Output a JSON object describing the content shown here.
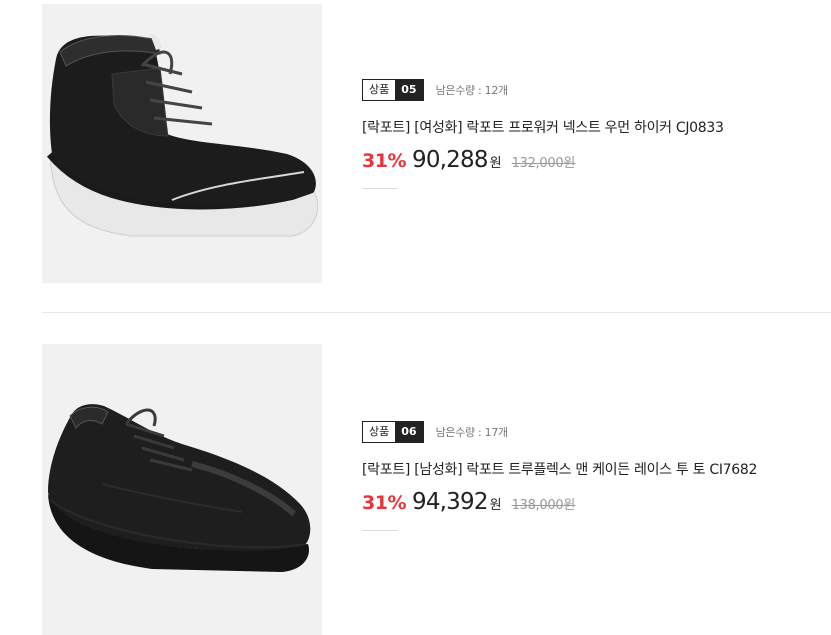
{
  "products": [
    {
      "badge_label": "상품",
      "badge_number": "05",
      "stock_text": "남은수량 : 12개",
      "title": "[락포트] [여성화] 락포트 프로워커 넥스트 우먼 하이커 CJ0833",
      "discount_rate": "31%",
      "sale_price": "90,288",
      "sale_currency": "원",
      "original_price": "132,000",
      "original_currency": "원"
    },
    {
      "badge_label": "상품",
      "badge_number": "06",
      "stock_text": "남은수량 : 17개",
      "title": "[락포트] [남성화] 락포트 트루플렉스 맨 케이든 레이스 투 토 CI7682",
      "discount_rate": "31%",
      "sale_price": "94,392",
      "sale_currency": "원",
      "original_price": "138,000",
      "original_currency": "원"
    }
  ],
  "colors": {
    "discount": "#e8343a",
    "badge_dark": "#222222",
    "thumb_bg": "#f1f1f1"
  }
}
